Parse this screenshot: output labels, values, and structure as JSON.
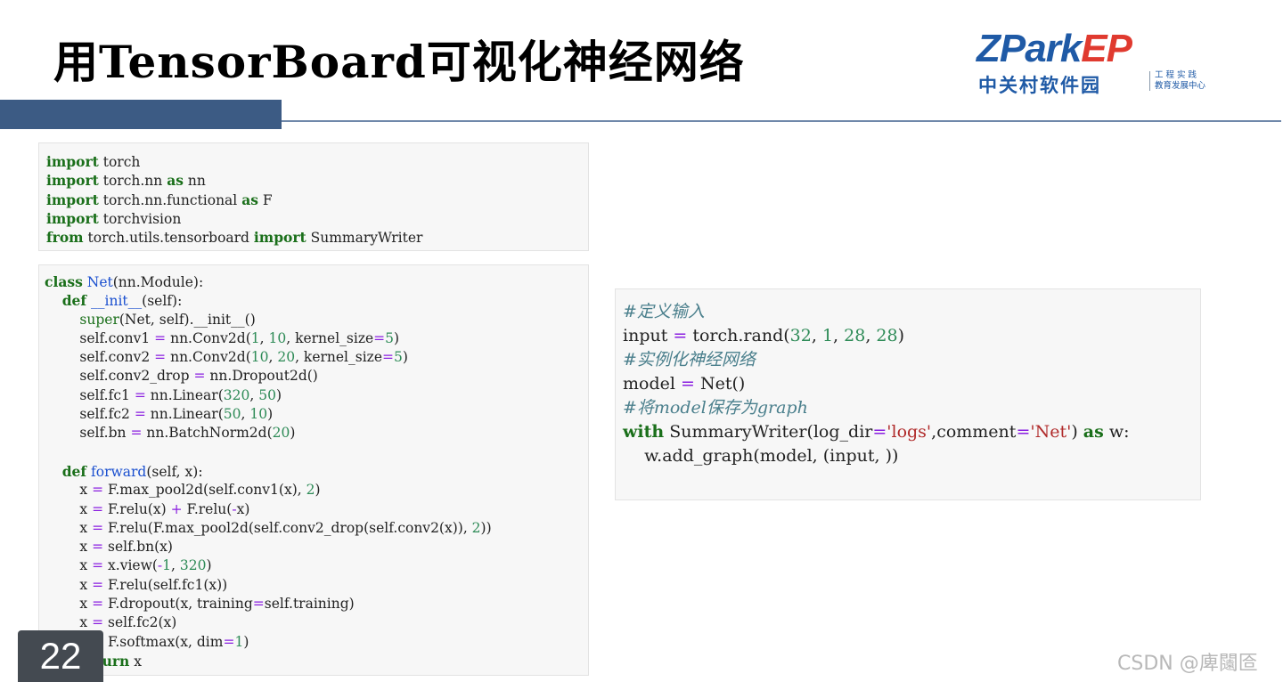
{
  "slide": {
    "title": "用TensorBoard可视化神经网络",
    "page_number": "22",
    "watermark": "CSDN @庳闧匼"
  },
  "logo": {
    "brand_main": "ZPark",
    "brand_ep": "EP",
    "brand_cn": "中关村软件园",
    "brand_sub_line1": "工 程 实 践",
    "brand_sub_line2": "教育发展中心"
  },
  "code_cells": [
    {
      "lines": [
        "import torch",
        "import torch.nn as nn",
        "import torch.nn.functional as F",
        "import torchvision",
        "from torch.utils.tensorboard import SummaryWriter"
      ]
    },
    {
      "lines": [
        "class Net(nn.Module):",
        "    def __init__(self):",
        "        super(Net, self).__init__()",
        "        self.conv1 = nn.Conv2d(1, 10, kernel_size=5)",
        "        self.conv2 = nn.Conv2d(10, 20, kernel_size=5)",
        "        self.conv2_drop = nn.Dropout2d()",
        "        self.fc1 = nn.Linear(320, 50)",
        "        self.fc2 = nn.Linear(50, 10)",
        "        self.bn = nn.BatchNorm2d(20)",
        "",
        "    def forward(self, x):",
        "        x = F.max_pool2d(self.conv1(x), 2)",
        "        x = F.relu(x) + F.relu(-x)",
        "        x = F.relu(F.max_pool2d(self.conv2_drop(self.conv2(x)), 2))",
        "        x = self.bn(x)",
        "        x = x.view(-1, 320)",
        "        x = F.relu(self.fc1(x))",
        "        x = F.dropout(x, training=self.training)",
        "        x = self.fc2(x)",
        "        x = F.softmax(x, dim=1)",
        "        return x"
      ]
    },
    {
      "lines": [
        "#定义输入",
        "input = torch.rand(32, 1, 28, 28)",
        "#实例化神经网络",
        "model = Net()",
        "#将model保存为graph",
        "with SummaryWriter(log_dir='logs',comment='Net') as w:",
        "    w.add_graph(model, (input, ))"
      ]
    }
  ]
}
